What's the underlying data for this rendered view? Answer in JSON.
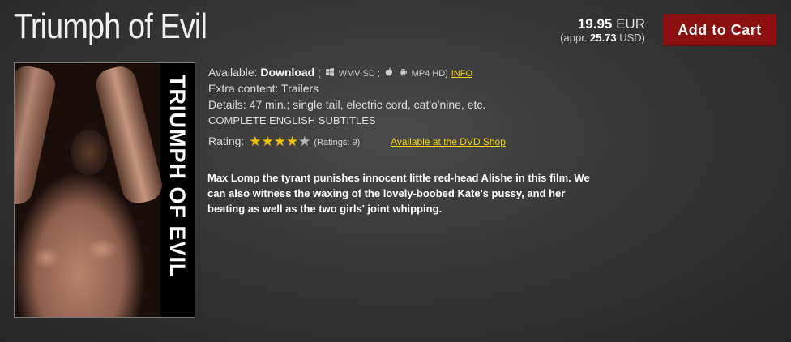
{
  "title": "Triumph of Evil",
  "price": {
    "amount": "19.95",
    "currency": "EUR",
    "approx_prefix": "(appr.",
    "approx_amount": "25.73",
    "approx_suffix": "USD)"
  },
  "cart_button_label": "Add to Cart",
  "poster": {
    "vertical_text": "TRIUMPH OF EVIL"
  },
  "info": {
    "available_label": "Available:",
    "available_value": "Download",
    "formats_open": "(",
    "format1": "WMV SD ;",
    "format2": "MP4 HD)",
    "info_link": "INFO",
    "extra_label": "Extra content:",
    "extra_value": "Trailers",
    "details_label": "Details:",
    "details_value": "47 min.; single tail, electric cord, cat'o'nine, etc.",
    "subtitles": "COMPLETE ENGLISH SUBTITLES",
    "rating_label": "Rating:",
    "rating_value": 4,
    "rating_max": 5,
    "ratings_count": "(Ratings: 9)",
    "dvd_link": "Available at the DVD Shop"
  },
  "description": "Max Lomp the tyrant punishes innocent little red-head Alishe in this film. We can also witness the waxing of the lovely-boobed Kate's pussy, and her beating as well as the two girls' joint whipping.",
  "icons": {
    "windows": "windows-icon",
    "apple": "apple-icon",
    "android": "android-icon",
    "star": "star-icon"
  },
  "colors": {
    "accent_button": "#8c1010",
    "link": "#f2d40a",
    "star_on": "#f2c400",
    "star_off": "#b9b9b9"
  }
}
